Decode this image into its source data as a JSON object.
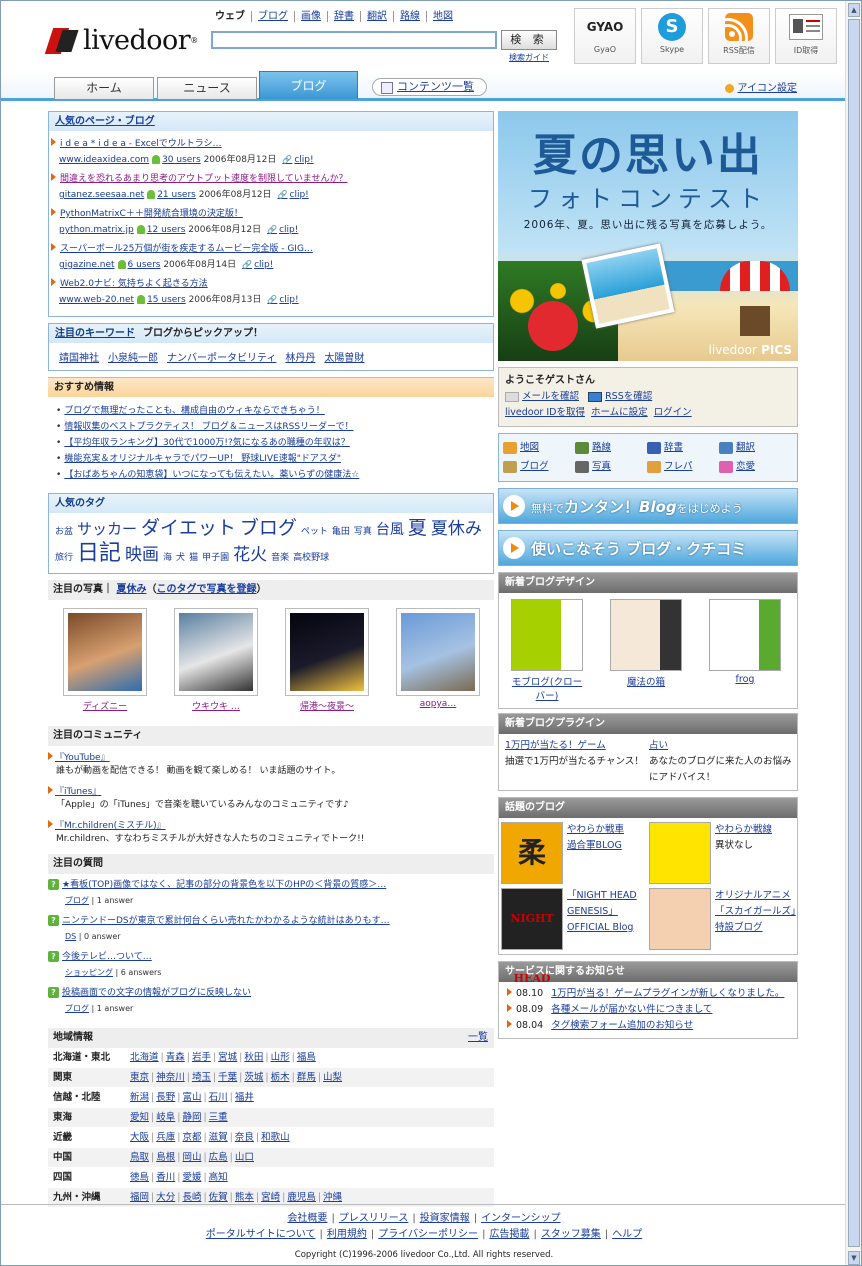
{
  "logo": {
    "text": "livedoor"
  },
  "search": {
    "nav": [
      "ウェブ",
      "ブログ",
      "画像",
      "辞書",
      "翻訳",
      "路線",
      "地図"
    ],
    "button": "検 索",
    "guide": "検索ガイド",
    "value": ""
  },
  "header_icons": [
    {
      "label": "GyaO",
      "icon": "gyao-icon"
    },
    {
      "label": "Skype",
      "icon": "skype-icon"
    },
    {
      "label": "RSS配信",
      "icon": "rss-icon"
    },
    {
      "label": "ID取得",
      "icon": "id-card-icon"
    }
  ],
  "gyao_mark": "GYAO",
  "tabs": [
    "ホーム",
    "ニュース",
    "ブログ"
  ],
  "active_tab": "ブログ",
  "contents_link": "コンテンツ一覧",
  "icon_settings": "アイコン設定",
  "popular_pages": {
    "title": "人気のページ・ブログ",
    "items": [
      {
        "title": "i d e a * i d e a - Excelでウルトラシ…",
        "site": "www.ideaxidea.com",
        "users": "30 users",
        "date": "2006年08月12日",
        "visited": false
      },
      {
        "title": "間違えを恐れるあまり思考のアウトプット速度を制限していませんか？",
        "site": "gitanez.seesaa.net",
        "users": "21 users",
        "date": "2006年08月12日",
        "visited": true
      },
      {
        "title": "PythonMatrixC＋＋開発統合環境の決定版！",
        "site": "python.matrix.jp",
        "users": "12 users",
        "date": "2006年08月12日",
        "visited": false
      },
      {
        "title": "スーパーボール25万個が街を疾走するムービー完全版 - GIG…",
        "site": "gigazine.net",
        "users": "6 users",
        "date": "2006年08月14日",
        "visited": false
      },
      {
        "title": "Web2.0ナビ: 気持ちよく起きる方法",
        "site": "www.web-20.net",
        "users": "15 users",
        "date": "2006年08月13日",
        "visited": false
      }
    ],
    "clip": "clip!"
  },
  "keywords": {
    "title": "注目のキーワード",
    "subtitle": "ブログからピックアップ！",
    "items": [
      "靖国神社",
      "小泉純一郎",
      "ナンバーポータビリティ",
      "林丹丹",
      "太陽曽財"
    ]
  },
  "recommend": {
    "title": "おすすめ情報",
    "items": [
      "ブログで無理だったことも、構成自由のウィキならできちゃう！",
      "情報収集のベストプラクティス！ ブログ＆ニュースはRSSリーダーで！",
      "【平均年収ランキング】30代で1000万!?気になるあの職種の年収は？",
      "機能充実＆オリジナルキャラでパワーUP！ 野球LIVE速報\"ドアスダ\"",
      "【おばあちゃんの知恵袋】いつになっても伝えたい。薬いらずの健康法☆"
    ]
  },
  "tags": {
    "title": "人気のタグ",
    "items": [
      {
        "t": "お盆",
        "s": 9
      },
      {
        "t": "サッカー",
        "s": 15
      },
      {
        "t": "ダイエット",
        "s": 19
      },
      {
        "t": "ブログ",
        "s": 19
      },
      {
        "t": "ペット",
        "s": 9
      },
      {
        "t": "亀田",
        "s": 9
      },
      {
        "t": "写真",
        "s": 9
      },
      {
        "t": "台風",
        "s": 14
      },
      {
        "t": "夏",
        "s": 19
      },
      {
        "t": "夏休み",
        "s": 17
      },
      {
        "t": "旅行",
        "s": 9
      },
      {
        "t": "日記",
        "s": 22
      },
      {
        "t": "映画",
        "s": 17
      },
      {
        "t": "海",
        "s": 9
      },
      {
        "t": "犬",
        "s": 9
      },
      {
        "t": "猫",
        "s": 9
      },
      {
        "t": "甲子園",
        "s": 9
      },
      {
        "t": "花火",
        "s": 17
      },
      {
        "t": "音楽",
        "s": 9
      },
      {
        "t": "高校野球",
        "s": 9
      }
    ]
  },
  "photos": {
    "title": "注目の写真",
    "tag": "夏休み",
    "register": "このタグで写真を登録",
    "items": [
      {
        "caption": "ディズニー",
        "colors": [
          "#7a4a2a",
          "#d7a070",
          "#2e6db0"
        ]
      },
      {
        "caption": "ウキウキ …",
        "colors": [
          "#5a7fa0",
          "#e6e6e6",
          "#333"
        ]
      },
      {
        "caption": "帰港〜夜景〜",
        "colors": [
          "#050510",
          "#1a1a2a",
          "#f0c040"
        ]
      },
      {
        "caption": "aopya…",
        "colors": [
          "#6a9ad8",
          "#a6c2e2",
          "#7a6a50"
        ]
      }
    ]
  },
  "community": {
    "title": "注目のコミュニティ",
    "items": [
      {
        "title": "『YouTube』",
        "desc": "誰もが動画を配信できる！ 動画を観て楽しめる！ いま話題のサイト。"
      },
      {
        "title": "『iTunes』",
        "desc": "「Apple」の「iTunes」で音楽を聴いているみんなのコミュニティです♪"
      },
      {
        "title": "『Mr.children(ミスチル)』",
        "desc": "Mr.children、すなわちミスチルが大好きな人たちのコミュニティでトーク!!"
      }
    ]
  },
  "questions": {
    "title": "注目の質問",
    "items": [
      {
        "q": "★看板(TOP)画像ではなく、記事の部分の背景色を以下のHPの＜背景の質感＞…",
        "cat": "ブログ",
        "ans": "1 answer"
      },
      {
        "q": "ニンテンドーDSが東京で累計何台くらい売れたかわかるような統計はありもす…",
        "cat": "DS",
        "ans": "0 answer"
      },
      {
        "q": "今後テレビ…ついて…",
        "cat": "ショッピング",
        "ans": "6 answers"
      },
      {
        "q": "投稿画面での文字の情報がブログに反映しない",
        "cat": "ブログ",
        "ans": "1 answer"
      }
    ]
  },
  "regions": {
    "title": "地域情報",
    "list_link": "一覧",
    "rows": [
      {
        "name": "北海道・東北",
        "places": [
          "北海道",
          "青森",
          "岩手",
          "宮城",
          "秋田",
          "山形",
          "福島"
        ]
      },
      {
        "name": "関東",
        "places": [
          "東京",
          "神奈川",
          "埼玉",
          "千葉",
          "茨城",
          "栃木",
          "群馬",
          "山梨"
        ]
      },
      {
        "name": "信越・北陸",
        "places": [
          "新潟",
          "長野",
          "富山",
          "石川",
          "福井"
        ]
      },
      {
        "name": "東海",
        "places": [
          "愛知",
          "岐阜",
          "静岡",
          "三重"
        ]
      },
      {
        "name": "近畿",
        "places": [
          "大阪",
          "兵庫",
          "京都",
          "滋賀",
          "奈良",
          "和歌山"
        ]
      },
      {
        "name": "中国",
        "places": [
          "鳥取",
          "島根",
          "岡山",
          "広島",
          "山口"
        ]
      },
      {
        "name": "四国",
        "places": [
          "徳島",
          "香川",
          "愛媛",
          "高知"
        ]
      },
      {
        "name": "九州・沖縄",
        "places": [
          "福岡",
          "大分",
          "長崎",
          "佐賀",
          "熊本",
          "宮崎",
          "鹿児島",
          "沖縄"
        ]
      }
    ]
  },
  "banner": {
    "title": "夏の思い出",
    "subtitle": "フォトコンテスト",
    "text": "2006年、夏。思い出に残る写真を応募しよう。",
    "brand": "livedoor",
    "brand2": "PICS"
  },
  "welcome": {
    "title": "ようこそゲストさん",
    "mail": "メールを確認",
    "rss": "RSSを確認",
    "links": [
      "livedoor IDを取得",
      "ホームに設定",
      "ログイン"
    ]
  },
  "services": [
    {
      "label": "地図",
      "icon": "map-icon",
      "color": "#e8a030"
    },
    {
      "label": "路線",
      "icon": "train-icon",
      "color": "#5a8a3a"
    },
    {
      "label": "辞書",
      "icon": "dictionary-icon",
      "color": "#3a60b0"
    },
    {
      "label": "翻訳",
      "icon": "translate-icon",
      "color": "#4a80c0"
    },
    {
      "label": "ブログ",
      "icon": "pen-icon",
      "color": "#c0a050"
    },
    {
      "label": "写真",
      "icon": "camera-icon",
      "color": "#666"
    },
    {
      "label": "フレパ",
      "icon": "face-icon",
      "color": "#e0a040"
    },
    {
      "label": "恋愛",
      "icon": "heart-icon",
      "color": "#e060b0"
    }
  ],
  "promo1": {
    "pre": "無料で",
    "main": "カンタン！",
    "blog": "Blog",
    "post": "をはじめよう"
  },
  "promo2": {
    "text": "使いこなそう ブログ・クチコミ"
  },
  "new_designs": {
    "title": "新着ブログデザイン",
    "items": [
      {
        "caption": "モブログ(クローバー)",
        "c1": "#a6d000",
        "c2": "#fff"
      },
      {
        "caption": "魔法の箱",
        "c1": "#f5e8d8",
        "c2": "#333"
      },
      {
        "caption": "frog",
        "c1": "#fff",
        "c2": "#5aaa30"
      }
    ]
  },
  "new_plugins": {
    "title": "新着ブログプラグイン",
    "items": [
      {
        "title": "1万円が当たる！ゲーム",
        "desc": "抽選で1万円が当たるチャンス！"
      },
      {
        "title": "占い",
        "desc": "あなたのブログに来た人のお悩みにアドバイス！"
      }
    ]
  },
  "topic_blogs": {
    "title": "話題のブログ",
    "items": [
      {
        "text": [
          "やわらか戦車",
          "過合軍BLOG"
        ],
        "links": [
          true,
          true
        ],
        "img": "#f0a800",
        "mark": "柔"
      },
      {
        "text": [
          "やわらか戦線",
          "異状なし"
        ],
        "links": [
          true,
          false
        ],
        "img": "#ffe400",
        "mark": ""
      },
      {
        "text": [
          "「NIGHT HEAD",
          "GENESIS」",
          "OFFICIAL Blog"
        ],
        "links": [
          true,
          true,
          true
        ],
        "img": "#222",
        "mark": "NIGHT HEAD"
      },
      {
        "text": [
          "オリジナルアニメ「スカイガールズ」特設ブログ"
        ],
        "links": [
          true
        ],
        "img": "#f4d0b0",
        "mark": ""
      }
    ]
  },
  "service_news": {
    "title": "サービスに関するお知らせ",
    "items": [
      {
        "date": "08.10",
        "text": "1万円が当る！ゲームプラグインが新しくなりました。"
      },
      {
        "date": "08.09",
        "text": "各種メールが届かない件につきまして"
      },
      {
        "date": "08.04",
        "text": "タグ検索フォーム追加のお知らせ"
      }
    ]
  },
  "footer": {
    "row1": [
      "会社概要",
      "プレスリリース",
      "投資家情報",
      "インターンシップ"
    ],
    "row2": [
      "ポータルサイトについて",
      "利用規約",
      "プライバシーポリシー",
      "広告掲載",
      "スタッフ募集",
      "ヘルプ"
    ],
    "copyright": "Copyright (C)1996-2006 livedoor Co.,Ltd. All rights reserved."
  }
}
